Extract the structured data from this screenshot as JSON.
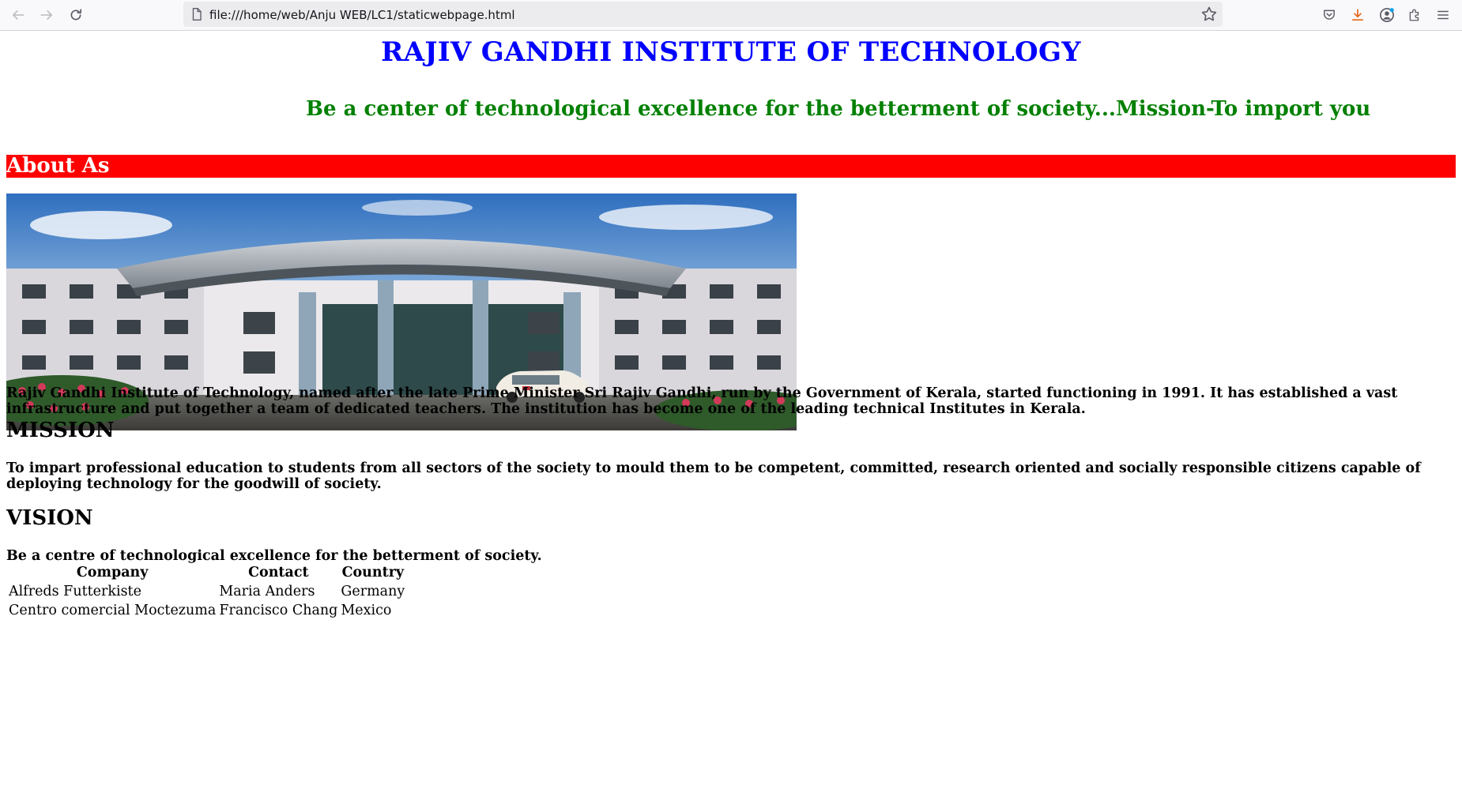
{
  "browser": {
    "url": "file:///home/web/Anju WEB/LC1/staticwebpage.html"
  },
  "page": {
    "title": "RAJIV GANDHI INSTITUTE OF TECHNOLOGY",
    "marquee": "Be a center of technological excellence for the betterment of society...Mission-To import you",
    "about_heading": "About As",
    "campus_image_alt": "Campus building",
    "about_text": "Rajiv Gandhi Institute of Technology, named after the late Prime Minister Sri Rajiv Gandhi, run by the Government of Kerala, started functioning in 1991. It has established a vast infrastructure and put together a team of dedicated teachers. The institution has become one of the leading technical Institutes in Kerala.",
    "mission_heading": "MISSION",
    "mission_text": "To impart professional education to students from all sectors of the society to mould them to be competent, committed, research oriented and socially responsible citizens capable of deploying technology for the goodwill of society.",
    "vision_heading": "VISION",
    "vision_text": "Be a centre of technological excellence for the betterment of society."
  },
  "table": {
    "headers": [
      "Company",
      "Contact",
      "Country"
    ],
    "rows": [
      [
        "Alfreds Futterkiste",
        "Maria Anders",
        "Germany"
      ],
      [
        "Centro comercial Moctezuma",
        "Francisco Chang",
        "Mexico"
      ]
    ]
  },
  "colors": {
    "title": "#0000ff",
    "marquee": "#008000",
    "about_bar": "#ff0000"
  }
}
